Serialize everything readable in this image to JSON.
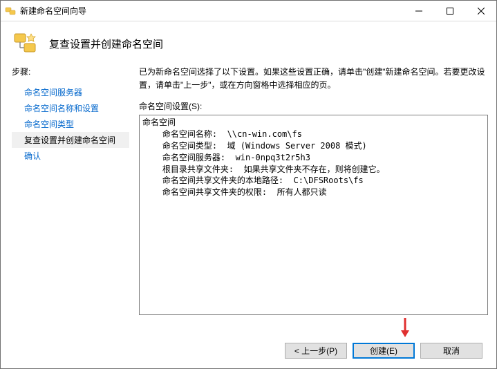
{
  "titlebar": {
    "title": "新建命名空间向导"
  },
  "header": {
    "title": "复查设置并创建命名空间"
  },
  "sidebar": {
    "header": "步骤:",
    "items": [
      {
        "label": "命名空间服务器"
      },
      {
        "label": "命名空间名称和设置"
      },
      {
        "label": "命名空间类型"
      },
      {
        "label": "复查设置并创建命名空间"
      },
      {
        "label": "确认"
      }
    ]
  },
  "content": {
    "instruction": "已为新命名空间选择了以下设置。如果这些设置正确，请单击\"创建\"新建命名空间。若要更改设置，请单击\"上一步\"，或在方向窗格中选择相应的页。",
    "settings_label": "命名空间设置(S):",
    "settings_text": "命名空间\n    命名空间名称:  \\\\cn-win.com\\fs\n    命名空间类型:  域 (Windows Server 2008 模式)\n    命名空间服务器:  win-0npq3t2r5h3\n    根目录共享文件夹:  如果共享文件夹不存在，则将创建它。\n    命名空间共享文件夹的本地路径:  C:\\DFSRoots\\fs\n    命名空间共享文件夹的权限:  所有人都只读"
  },
  "footer": {
    "previous": "< 上一步(P)",
    "create": "创建(E)",
    "cancel": "取消"
  }
}
